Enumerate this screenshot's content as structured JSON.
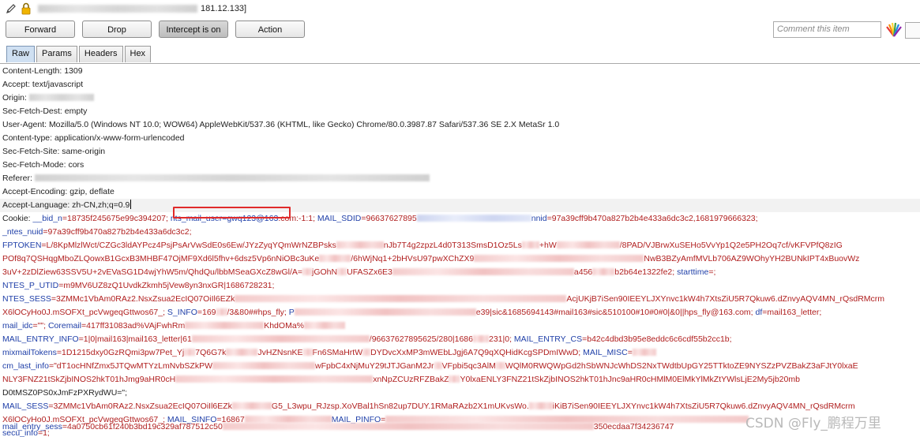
{
  "host": {
    "suffix": "181.12.133]"
  },
  "toolbar": {
    "forward": "Forward",
    "drop": "Drop",
    "intercept": "Intercept is on",
    "action": "Action",
    "comment_placeholder": "Comment this item"
  },
  "tabs": [
    "Raw",
    "Params",
    "Headers",
    "Hex"
  ],
  "headers": {
    "l1": "Content-Length: 1309",
    "l2": "Accept: text/javascript",
    "l3_prefix": "Origin: ",
    "l4": "Sec-Fetch-Dest: empty",
    "l5": "User-Agent: Mozilla/5.0 (Windows NT 10.0; WOW64) AppleWebKit/537.36 (KHTML, like Gecko) Chrome/80.0.3987.87 Safari/537.36 SE 2.X MetaSr 1.0",
    "l6": "Content-type: application/x-www-form-urlencoded",
    "l7": "Sec-Fetch-Site: same-origin",
    "l8": "Sec-Fetch-Mode: cors",
    "l9_prefix": "Referer: ",
    "l10": "Accept-Encoding: gzip, deflate",
    "l11": "Accept-Language: zh-CN,zh;q=0.9"
  },
  "cookie": {
    "c1a": "Cookie: ",
    "c1b": "__bid_n",
    "c1c": "=18735f245675e99c394207;",
    "c1d": "nts_mail_user=gwq123@163",
    "c1e": ".com:-1:1;",
    "c1f": " MAIL_SDID",
    "c1g": "=96637627895",
    "c1h": "nnid",
    "c1i": "=97a39cff9b470a827b2b4e433a6dc3c2,1681979666323;",
    "c2a": "_ntes_nuid",
    "c2b": "=97a39cff9b470a827b2b4e433a6dc3c2;",
    "c3a": "FPTOKEN",
    "c3b": "=L/8KpMlzlWct/CZGc3ldAYPcz4PsjPsArVwSdE0s6Ew/JYzZyqYQmWrNZBPsks",
    "c3c": "nJb7T4g2zpzL4d0T313SmsD1Oz5Ls",
    "c3d": "+hW",
    "c3e": "/8PAD/VJBrwXuSEHo5VvYp1Q2e5PH2Oq7cf/vKFVPfQ8zIG",
    "c4a": "POf8q7QSHqgMboZLQowxB1GcxB3MHBF47OjMF9Xd6l5fhv+6dsz5Vp6nNiOBc3uKe",
    "c4b": "/6hWjNq1+2bHVsU97pwXChZX9",
    "c4c": "NwB3BZyAmfMVLb706AZ9WOhyYH2BUNkIPT4xBuovWz",
    "c5a": "3uV+2zDlZiew63SSV5U+2vEVaSG1D4wjYhW5m/QhdQu/lbbMSeaGXcZ8wGl/A=",
    "c5b": "jGOhN",
    "c5c": "UFASZx6E3",
    "c5d": "a456",
    "c5e": "b2b64e1322fe2;",
    "c5f": " starttime",
    "c5g": "=;",
    "c6a": "NTES_P_UTID",
    "c6b": "=m9MV6UZ8zQ1UvdkZkmh5jVew8yn3nxGR|1686728231;",
    "c7a": "NTES_SESS",
    "c7b": "=3ZMMc1VbAm0RAz2.NsxZsua2EcIQ07OiIl6EZk",
    "c7c": "AcjUKjB7iSen90IEEYLJXYnvc1kW4h7XtsZiU5R7Qkuw6.dZnvyAQV4MN_rQsdRMcrm",
    "c8a": "X6lOCyHo0J.mSOFXt_pcVwgeqGttwos67_;",
    "c8b": " S_INFO",
    "c8c": "=169",
    "c8d": "/3&80##hps_fly;",
    "c8e": " P",
    "c8f": "e39|sic&1685694143#mail163#sic&510100#10#0#0|&0||hps_fly@163.com;",
    "c8g": " df",
    "c8h": "=mail163_letter;",
    "c9a": "mail_idc",
    "c9b": "=\"\";",
    "c9c": " Coremail",
    "c9d": "=417ff31083ad%VAjFwhRm",
    "c9e": "KhdOMa%",
    "c10a": "MAIL_ENTRY_INFO",
    "c10b": "=1|0|mail163|mail163_letter|61",
    "c10c": "/96637627895625/280|1686",
    "c10d": "231|0;",
    "c10e": " MAIL_ENTRY_CS",
    "c10f": "=b42c4dbd3b95e8eddc6c6cdf55b2cc1b;",
    "c11a": "mixmailTokens",
    "c11b": "=1D1215dxy0GzRQmi3pw7Pet_Yj",
    "c11c": "7Q6G7k",
    "c11d": "JvHZNsnKE",
    "c11e": "Fn6SMaHrtW",
    "c11f": "DYDvcXxMP3mWEbLJgj6A7Q9qXQHidKcgSPDmIWwD;",
    "c11g": " MAIL_MISC",
    "c11h": "=",
    "c12a": "cm_last_info",
    "c12b": "=\"dT1ocHNfZmx5JTQwMTYzLmNvbSZkPW",
    "c12c": "wFpbC4xNjMuY29tJTJGanM2Jr",
    "c12d": "VFpbi5qc3AlM",
    "c12e": "WQlM0RWQWpGd2hSbWNJcWhDS2NxTWdtbUpGY25TTktoZE9NYSZzPVZBakZ3aFJtY0lxaE",
    "c13a": "NLY3FNZ21tSkZjbINOS2hkT01hJmg9aHR0cH",
    "c13b": "xnNpZCUzRFZBakZ",
    "c13c": "Y0lxaENLY3FNZ21tSkZjbINOS2hkT01hJnc9aHR0cHMlM0ElMkYlMkZtYWlsLjE2My5jb20mb",
    "c14a": "D0tMSZ0PS0xJmFzPXRydWU=\";",
    "c15a": "MAIL_SESS",
    "c15b": "=3ZMMc1VbAm0RAz2.NsxZsua2EcIQ07OiIl6EZk",
    "c15c": "G5_L3wpu_RJzsp.XoVBal1hSn82up7DUY.1RMaRAzb2X1mUKvsWo.",
    "c15d": "iKiB7iSen90IEEYLJXYnvc1kW4h7XtsZiU5R7Qkuw6.dZnvyAQV4MN_rQsdRMcrm",
    "c16a": "X6lOCyHo0J.mSOFXt_pcVwgeqGttwos67_;",
    "c16b": " MAIL_SINFO",
    "c16c": "=16867",
    "c16d": "MAIL_PINFO",
    "c16e": "=",
    "c17a": "secu_info",
    "c17b": "=1;",
    "c18a": "mail_entry_sess",
    "c18b": "=4a0750cb61f240b3bd19c329af787512c50",
    "c18c": "350ecdaa7f34236747"
  },
  "watermark": "CSDN @Fly_鹏程万里"
}
